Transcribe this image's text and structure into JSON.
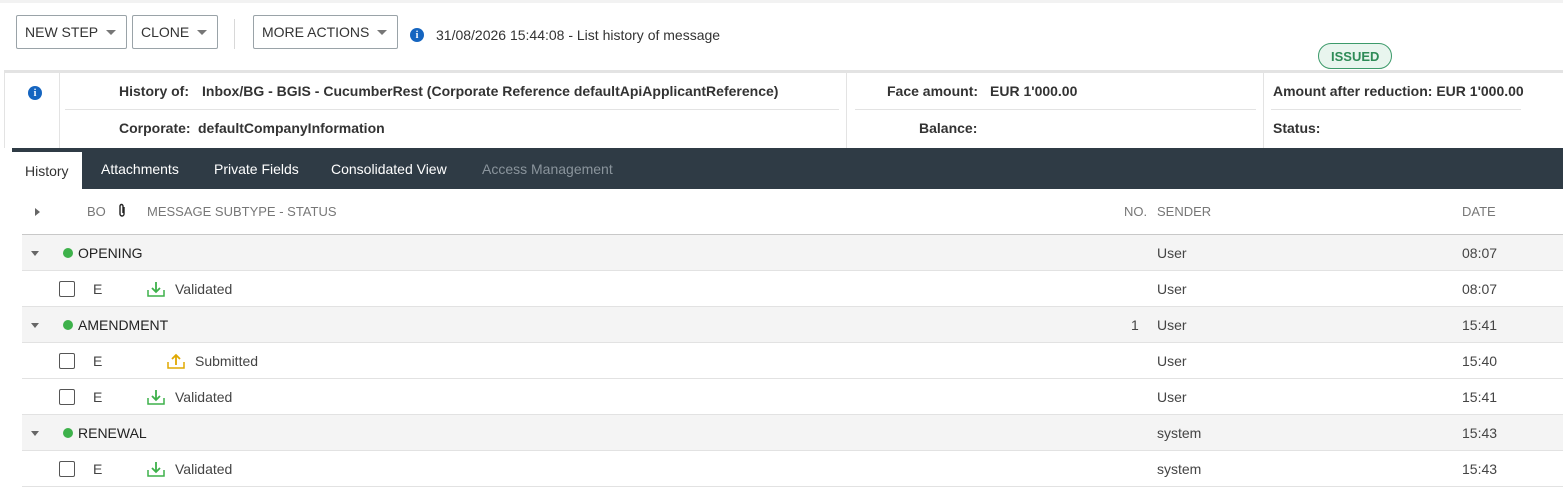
{
  "toolbar": {
    "new_step": "NEW STEP",
    "clone": "CLONE",
    "more_actions": "MORE ACTIONS",
    "info_message": "31/08/2026 15:44:08 - List history of message"
  },
  "header": {
    "history_of_label": "History of:",
    "history_of_value": "Inbox/BG - BGIS - CucumberRest (Corporate Reference defaultApiApplicantReference)",
    "corporate_label": "Corporate:",
    "corporate_value": "defaultCompanyInformation",
    "face_amount_label": "Face amount:",
    "face_amount_value": "EUR 1'000.00",
    "balance_label": "Balance:",
    "amount_after_reduction": "Amount after reduction: EUR 1'000.00",
    "status_label": "Status:",
    "status_value": "ISSUED"
  },
  "tabs": [
    {
      "label": "History"
    },
    {
      "label": "Attachments"
    },
    {
      "label": "Private Fields"
    },
    {
      "label": "Consolidated View"
    },
    {
      "label": "Access Management"
    }
  ],
  "grid": {
    "columns": {
      "bo": "BO",
      "subtype_status": "MESSAGE SUBTYPE - STATUS",
      "no": "NO.",
      "sender": "SENDER",
      "date": "DATE"
    },
    "rows": [
      {
        "name": "OPENING",
        "no": "",
        "sender": "User",
        "date": "08:07"
      },
      {
        "bo": "E",
        "status": "Validated",
        "sender": "User",
        "date": "08:07"
      },
      {
        "name": "AMENDMENT",
        "no": "1",
        "sender": "User",
        "date": "15:41"
      },
      {
        "bo": "E",
        "status": "Submitted",
        "sender": "User",
        "date": "15:40"
      },
      {
        "bo": "E",
        "status": "Validated",
        "sender": "User",
        "date": "15:41"
      },
      {
        "name": "RENEWAL",
        "no": "",
        "sender": "system",
        "date": "15:43"
      },
      {
        "bo": "E",
        "status": "Validated",
        "sender": "system",
        "date": "15:43"
      }
    ]
  },
  "colors": {
    "tab_bar": "#2f3b45",
    "info_icon": "#1565c0",
    "status_dot": "#3db14a",
    "validated_icon": "#3db14a",
    "submitted_icon": "#e0a800",
    "badge_green": "#2e8b57"
  }
}
